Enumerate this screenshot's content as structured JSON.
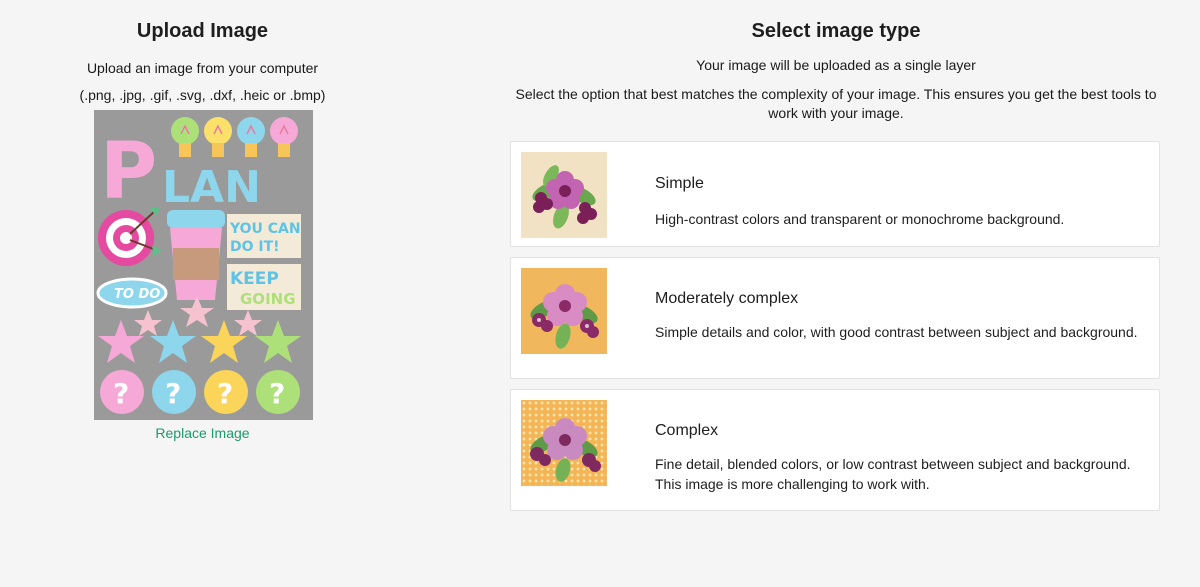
{
  "upload": {
    "title": "Upload Image",
    "subtitle": "Upload an image from your computer",
    "formats": "(.png, .jpg, .gif, .svg, .dxf, .heic or .bmp)",
    "preview_text": {
      "plan_p": "P",
      "plan_rest": "LAN",
      "you_can": "YOU CAN",
      "do_it": "DO IT!",
      "keep": "KEEP",
      "going": "GOING",
      "to_do": "TO DO",
      "question": "?"
    },
    "replace_label": "Replace Image"
  },
  "type_select": {
    "title": "Select image type",
    "layer_note": "Your image will be uploaded as a single layer",
    "description": "Select the option that best matches the complexity of your image. This ensures you get the best tools to work with your image.",
    "options": [
      {
        "title": "Simple",
        "text": "High-contrast colors and transparent or monochrome background.",
        "thumb_bg": "#f1e2c4"
      },
      {
        "title": "Moderately complex",
        "text": "Simple details and color, with good contrast between subject and background.",
        "thumb_bg": "#f0b75c"
      },
      {
        "title": "Complex",
        "text": "Fine detail, blended colors, or low contrast between subject and background. This image is more challenging to work with.",
        "thumb_bg": "#f3b556"
      }
    ]
  },
  "colors": {
    "accent": "#1a9b6c",
    "page_bg": "#f5f5f5",
    "preview_bg": "#9a9a9a"
  }
}
